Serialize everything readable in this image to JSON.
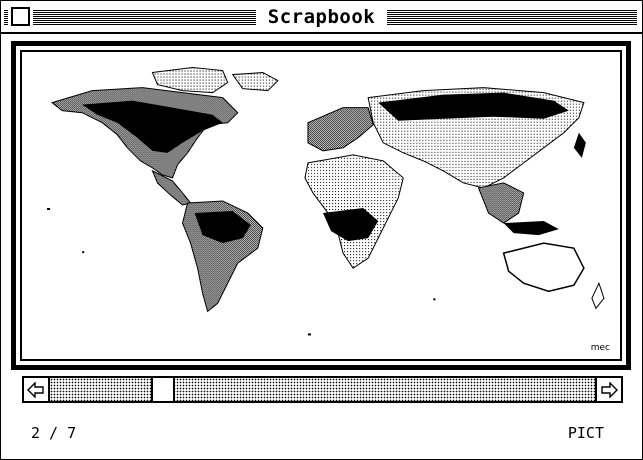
{
  "window": {
    "title": "Scrapbook"
  },
  "icons": {
    "close_box": "close-box-icon",
    "scroll_left": "left-arrow-icon",
    "scroll_right": "right-arrow-icon"
  },
  "scrapbook": {
    "credit": "mec",
    "picture_description_icon": "world-map-image"
  },
  "scrollbar": {
    "position_fraction": 0.194
  },
  "status": {
    "page": "2 / 7",
    "type": "PICT"
  }
}
